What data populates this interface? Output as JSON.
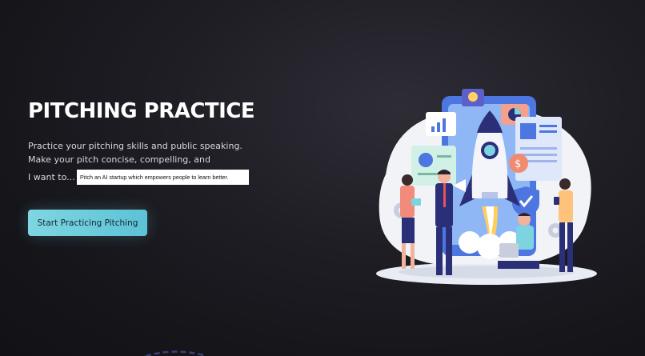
{
  "hero": {
    "title": "PITCHING PRACTICE",
    "description_line1": "Practice your pitching skills and public speaking.",
    "description_line2": "Make your pitch concise, compelling, and",
    "prompt_label": "I want to...",
    "prompt_value": "Pitch an AI startup which empowers people to learn better.",
    "cta_label": "Start Practicing Pitching"
  },
  "colors": {
    "background": "#1c1b22",
    "accent": "#6fcddc",
    "text": "#ffffff"
  },
  "illustration": {
    "name": "startup-rocket-team-illustration"
  }
}
